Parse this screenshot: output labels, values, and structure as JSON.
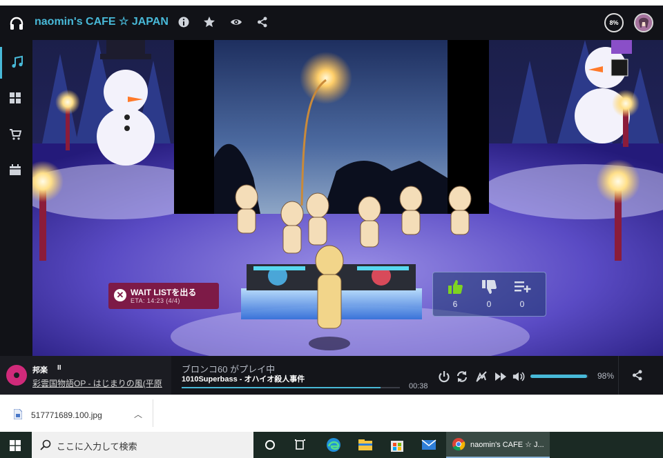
{
  "app": {
    "room_title": "naomin's CAFE ☆ JAPAN",
    "volume_badge": "8%"
  },
  "sidebar": {
    "items": [
      {
        "icon": "music-note-icon",
        "active": true
      },
      {
        "icon": "grid-icon"
      },
      {
        "icon": "cart-icon"
      },
      {
        "icon": "calendar-icon"
      }
    ]
  },
  "waitlist": {
    "label": "WAIT LISTを出る",
    "eta": "ETA: 14:23 (4/4)"
  },
  "votes": {
    "woot": "6",
    "meh": "0",
    "grab": "0"
  },
  "player": {
    "genre": "邦楽",
    "pause_label": "II",
    "previous_song": "彩雲国物語OP - はじまりの風(平原",
    "dj_line": "ブロンコ60 がプレイ中",
    "track": "1010Superbass - オハイオ殺人事件",
    "time_remaining": "00:38",
    "progress": 0.91,
    "volume_percent": "98%",
    "volume": 0.98
  },
  "download": {
    "filename": "517771689.100.jpg"
  },
  "taskbar": {
    "search_placeholder": "ここに入力して検索",
    "chrome_label": "naomin's CAFE ☆ J..."
  },
  "colors": {
    "accent": "#48b9d8",
    "waitlist": "#7d1a47",
    "like": "#7ed321"
  }
}
